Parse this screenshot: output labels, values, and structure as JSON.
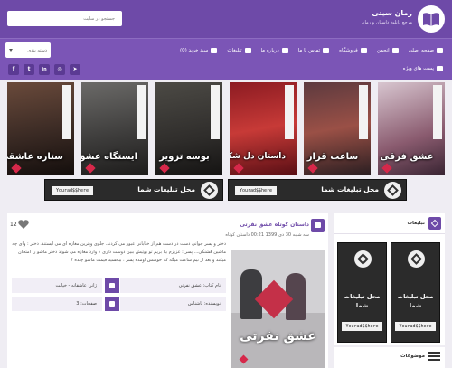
{
  "header": {
    "site_title": "رمان سیتی",
    "site_subtitle": "مرجع دانلود داستان و رمان",
    "search_placeholder": "جستجو در سایت",
    "brand_color": "#6e4aa8"
  },
  "menu": {
    "items": [
      {
        "label": "صفحه اصلی",
        "icon": "home-icon"
      },
      {
        "label": "انجمن",
        "icon": "forum-icon"
      },
      {
        "label": "فروشگاه",
        "icon": "cart-icon"
      },
      {
        "label": "تماس با ما",
        "icon": "envelope-icon"
      },
      {
        "label": "درباره ما",
        "icon": "info-icon"
      },
      {
        "label": "تبلیغات",
        "icon": "megaphone-icon"
      },
      {
        "label": "سبد خرید (0)",
        "icon": "basket-icon"
      }
    ],
    "category_select": "دسته بندی"
  },
  "social": {
    "icons": [
      "facebook-icon",
      "twitter-icon",
      "linkedin-icon",
      "instagram-icon",
      "telegram-icon"
    ],
    "glyphs": [
      "f",
      "t",
      "in",
      "◎",
      "➤"
    ]
  },
  "special_posts_label": "پست های ویژه",
  "covers": [
    {
      "title": "عشق فرقی"
    },
    {
      "title": "ساعت قرار"
    },
    {
      "title": "داستان دل شکسته"
    },
    {
      "title": "بوسه تزویر"
    },
    {
      "title": "ایستگاه عشق"
    },
    {
      "title": "ستاره عاشقی"
    }
  ],
  "banners": [
    {
      "text": "محل تبلیغات شما",
      "code": "Yourad$$here"
    },
    {
      "text": "محل تبلیغات شما",
      "code": "Yourad$$here"
    }
  ],
  "post": {
    "likes": "12",
    "title": "داستان کوتاه عشق نفرتی",
    "meta": "سه شنبه 30 دی 1399  00:21  داستان کوتاه",
    "excerpt": "دختر و پسر جوانی دست در دست هم از خیابانی عبور می کردند. جلوی ویترین مغازه ای می ایستند. دختر : وای چه ماشین قشنگی... پسر : عزیزم بیا بریم تو بوتیش ببین دوست داری ؟ وارد مغازه می شوند دختر ماشو را امتحان میکند و بعد از نیم ساعت میگه که خوشش اومده پسر : ببخشید قیمت ماشو چنده ؟",
    "image_title": "عشق نفرتی",
    "info": {
      "book_name": "نام کتاب: عشق نفرتی",
      "genre": "ژانر: عاشقانه - خیانت",
      "author": "نویسنده: ناشناس",
      "pages": "صفحات: 3"
    }
  },
  "sidebar": {
    "ads_title": "تبلیغات",
    "ad_text": "محل تبلیغات شما",
    "ad_code": "Yourad$$here",
    "topics_title": "موضوعات"
  }
}
